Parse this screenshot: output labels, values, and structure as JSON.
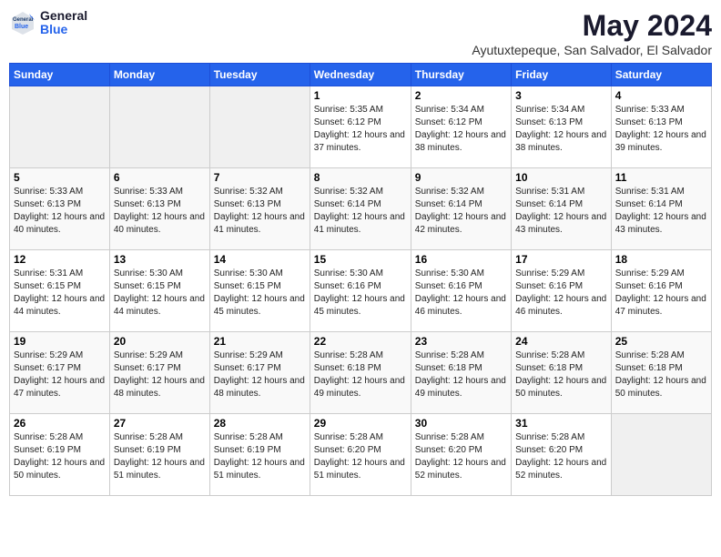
{
  "logo": {
    "general": "General",
    "blue": "Blue"
  },
  "header": {
    "month_year": "May 2024",
    "location": "Ayutuxtepeque, San Salvador, El Salvador"
  },
  "weekdays": [
    "Sunday",
    "Monday",
    "Tuesday",
    "Wednesday",
    "Thursday",
    "Friday",
    "Saturday"
  ],
  "weeks": [
    [
      {
        "day": "",
        "sunrise": "",
        "sunset": "",
        "daylight": "",
        "empty": true
      },
      {
        "day": "",
        "sunrise": "",
        "sunset": "",
        "daylight": "",
        "empty": true
      },
      {
        "day": "",
        "sunrise": "",
        "sunset": "",
        "daylight": "",
        "empty": true
      },
      {
        "day": "1",
        "sunrise": "Sunrise: 5:35 AM",
        "sunset": "Sunset: 6:12 PM",
        "daylight": "Daylight: 12 hours and 37 minutes."
      },
      {
        "day": "2",
        "sunrise": "Sunrise: 5:34 AM",
        "sunset": "Sunset: 6:12 PM",
        "daylight": "Daylight: 12 hours and 38 minutes."
      },
      {
        "day": "3",
        "sunrise": "Sunrise: 5:34 AM",
        "sunset": "Sunset: 6:13 PM",
        "daylight": "Daylight: 12 hours and 38 minutes."
      },
      {
        "day": "4",
        "sunrise": "Sunrise: 5:33 AM",
        "sunset": "Sunset: 6:13 PM",
        "daylight": "Daylight: 12 hours and 39 minutes."
      }
    ],
    [
      {
        "day": "5",
        "sunrise": "Sunrise: 5:33 AM",
        "sunset": "Sunset: 6:13 PM",
        "daylight": "Daylight: 12 hours and 40 minutes."
      },
      {
        "day": "6",
        "sunrise": "Sunrise: 5:33 AM",
        "sunset": "Sunset: 6:13 PM",
        "daylight": "Daylight: 12 hours and 40 minutes."
      },
      {
        "day": "7",
        "sunrise": "Sunrise: 5:32 AM",
        "sunset": "Sunset: 6:13 PM",
        "daylight": "Daylight: 12 hours and 41 minutes."
      },
      {
        "day": "8",
        "sunrise": "Sunrise: 5:32 AM",
        "sunset": "Sunset: 6:14 PM",
        "daylight": "Daylight: 12 hours and 41 minutes."
      },
      {
        "day": "9",
        "sunrise": "Sunrise: 5:32 AM",
        "sunset": "Sunset: 6:14 PM",
        "daylight": "Daylight: 12 hours and 42 minutes."
      },
      {
        "day": "10",
        "sunrise": "Sunrise: 5:31 AM",
        "sunset": "Sunset: 6:14 PM",
        "daylight": "Daylight: 12 hours and 43 minutes."
      },
      {
        "day": "11",
        "sunrise": "Sunrise: 5:31 AM",
        "sunset": "Sunset: 6:14 PM",
        "daylight": "Daylight: 12 hours and 43 minutes."
      }
    ],
    [
      {
        "day": "12",
        "sunrise": "Sunrise: 5:31 AM",
        "sunset": "Sunset: 6:15 PM",
        "daylight": "Daylight: 12 hours and 44 minutes."
      },
      {
        "day": "13",
        "sunrise": "Sunrise: 5:30 AM",
        "sunset": "Sunset: 6:15 PM",
        "daylight": "Daylight: 12 hours and 44 minutes."
      },
      {
        "day": "14",
        "sunrise": "Sunrise: 5:30 AM",
        "sunset": "Sunset: 6:15 PM",
        "daylight": "Daylight: 12 hours and 45 minutes."
      },
      {
        "day": "15",
        "sunrise": "Sunrise: 5:30 AM",
        "sunset": "Sunset: 6:16 PM",
        "daylight": "Daylight: 12 hours and 45 minutes."
      },
      {
        "day": "16",
        "sunrise": "Sunrise: 5:30 AM",
        "sunset": "Sunset: 6:16 PM",
        "daylight": "Daylight: 12 hours and 46 minutes."
      },
      {
        "day": "17",
        "sunrise": "Sunrise: 5:29 AM",
        "sunset": "Sunset: 6:16 PM",
        "daylight": "Daylight: 12 hours and 46 minutes."
      },
      {
        "day": "18",
        "sunrise": "Sunrise: 5:29 AM",
        "sunset": "Sunset: 6:16 PM",
        "daylight": "Daylight: 12 hours and 47 minutes."
      }
    ],
    [
      {
        "day": "19",
        "sunrise": "Sunrise: 5:29 AM",
        "sunset": "Sunset: 6:17 PM",
        "daylight": "Daylight: 12 hours and 47 minutes."
      },
      {
        "day": "20",
        "sunrise": "Sunrise: 5:29 AM",
        "sunset": "Sunset: 6:17 PM",
        "daylight": "Daylight: 12 hours and 48 minutes."
      },
      {
        "day": "21",
        "sunrise": "Sunrise: 5:29 AM",
        "sunset": "Sunset: 6:17 PM",
        "daylight": "Daylight: 12 hours and 48 minutes."
      },
      {
        "day": "22",
        "sunrise": "Sunrise: 5:28 AM",
        "sunset": "Sunset: 6:18 PM",
        "daylight": "Daylight: 12 hours and 49 minutes."
      },
      {
        "day": "23",
        "sunrise": "Sunrise: 5:28 AM",
        "sunset": "Sunset: 6:18 PM",
        "daylight": "Daylight: 12 hours and 49 minutes."
      },
      {
        "day": "24",
        "sunrise": "Sunrise: 5:28 AM",
        "sunset": "Sunset: 6:18 PM",
        "daylight": "Daylight: 12 hours and 50 minutes."
      },
      {
        "day": "25",
        "sunrise": "Sunrise: 5:28 AM",
        "sunset": "Sunset: 6:18 PM",
        "daylight": "Daylight: 12 hours and 50 minutes."
      }
    ],
    [
      {
        "day": "26",
        "sunrise": "Sunrise: 5:28 AM",
        "sunset": "Sunset: 6:19 PM",
        "daylight": "Daylight: 12 hours and 50 minutes."
      },
      {
        "day": "27",
        "sunrise": "Sunrise: 5:28 AM",
        "sunset": "Sunset: 6:19 PM",
        "daylight": "Daylight: 12 hours and 51 minutes."
      },
      {
        "day": "28",
        "sunrise": "Sunrise: 5:28 AM",
        "sunset": "Sunset: 6:19 PM",
        "daylight": "Daylight: 12 hours and 51 minutes."
      },
      {
        "day": "29",
        "sunrise": "Sunrise: 5:28 AM",
        "sunset": "Sunset: 6:20 PM",
        "daylight": "Daylight: 12 hours and 51 minutes."
      },
      {
        "day": "30",
        "sunrise": "Sunrise: 5:28 AM",
        "sunset": "Sunset: 6:20 PM",
        "daylight": "Daylight: 12 hours and 52 minutes."
      },
      {
        "day": "31",
        "sunrise": "Sunrise: 5:28 AM",
        "sunset": "Sunset: 6:20 PM",
        "daylight": "Daylight: 12 hours and 52 minutes."
      },
      {
        "day": "",
        "sunrise": "",
        "sunset": "",
        "daylight": "",
        "empty": true
      }
    ]
  ]
}
